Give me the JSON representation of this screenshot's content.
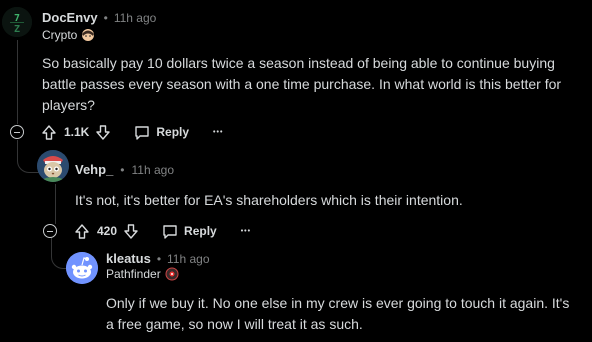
{
  "comments": [
    {
      "username": "DocEnvy",
      "dot": "•",
      "time": "11h ago",
      "flair": "Crypto",
      "body": [
        "So basically pay 10 dollars twice a season instead of being able to continue buying",
        "battle passes every season with a one time purchase. In what world is this better for",
        "players?"
      ],
      "votes": "1.1K",
      "reply_label": "Reply",
      "more_label": "•••"
    },
    {
      "username": "Vehp_",
      "dot": "•",
      "time": "11h ago",
      "body": [
        "It's not, it's better for EA's shareholders which is their intention."
      ],
      "votes": "420",
      "reply_label": "Reply",
      "more_label": "•••"
    },
    {
      "username": "kleatus",
      "dot": "•",
      "time": "11h ago",
      "flair": "Pathfinder",
      "body": [
        "Only if we buy it. No one else in my crew is ever going to touch it again. It's",
        "a free game, so now I will treat it as such."
      ]
    }
  ],
  "colors": {
    "background": "#000000",
    "text": "#d7dadc",
    "meta": "#818384",
    "thread_line": "#343536",
    "avatar_green": "#2e7d4f",
    "snoo_blue": "#7193ff"
  },
  "icons": [
    "upvote-icon",
    "downvote-icon",
    "comment-bubble-icon",
    "more-icon",
    "collapse-icon",
    "snoo-avatar",
    "flair-emoji"
  ]
}
